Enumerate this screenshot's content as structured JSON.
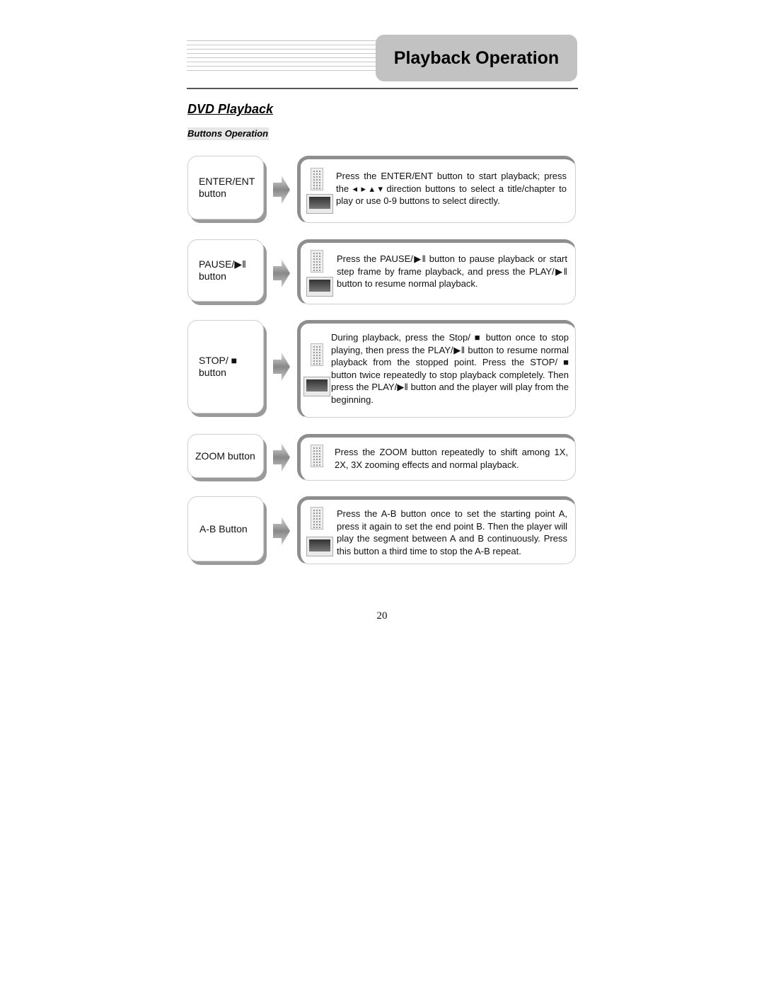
{
  "header": {
    "title": "Playback Operation"
  },
  "section": {
    "title": "DVD Playback",
    "subtitle": "Buttons Operation"
  },
  "rows": [
    {
      "label": "ENTER/ENT\nbutton",
      "description": "Press the ENTER/ENT button to start playback; press the ◂ ▸ ▴ ▾ direction buttons to select a title/chapter to play or use 0-9 buttons to select directly.",
      "icons": [
        "remote-icon",
        "tv-icon"
      ]
    },
    {
      "label": "PAUSE/▶‖\nbutton",
      "description": "Press the PAUSE/▶‖ button to pause playback or start step frame by frame playback, and press the PLAY/▶‖ button to resume normal playback.",
      "icons": [
        "remote-icon",
        "tv-icon"
      ]
    },
    {
      "label": "STOP/ ■\nbutton",
      "description": "During playback, press the Stop/ ■ button once to stop playing, then press the PLAY/▶‖ button to resume normal playback from the stopped point. Press the STOP/ ■ button twice repeatedly to stop playback completely. Then press the PLAY/▶‖ button and the player will play from the beginning.",
      "icons": [
        "remote-icon",
        "tv-icon"
      ]
    },
    {
      "label": "ZOOM button",
      "description": "Press the ZOOM button repeatedly to shift among 1X, 2X, 3X zooming effects and normal playback.",
      "icons": [
        "remote-icon"
      ]
    },
    {
      "label": "A-B Button",
      "description": "Press the A-B button once to set the starting point A, press it again to set the end point B. Then the player will play the segment between A and B continuously. Press this button a third time to stop the A-B repeat.",
      "icons": [
        "remote-icon",
        "tv-icon"
      ]
    }
  ],
  "footer": {
    "page_number": "20"
  }
}
